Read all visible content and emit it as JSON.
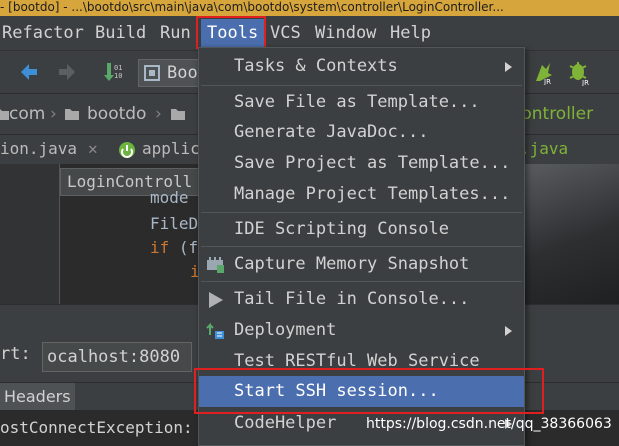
{
  "window": {
    "title": "- [bootdo] - ...\\bootdo\\src\\main\\java\\com\\bootdo\\system\\controller\\LoginController..."
  },
  "menubar": {
    "items": [
      {
        "label": "Refactor"
      },
      {
        "label": "Build"
      },
      {
        "label": "Run"
      },
      {
        "label": "Tools",
        "active": true
      },
      {
        "label": "VCS"
      },
      {
        "label": "Window"
      },
      {
        "label": "Help"
      }
    ]
  },
  "toolbar": {
    "run_config_label": "Boo",
    "icons": [
      "back-arrow-icon",
      "forward-arrow-icon",
      "build-icon",
      "run-config-icon",
      "jrebel-icon",
      "jrebel-debug-icon"
    ]
  },
  "breadcrumbs": {
    "items": [
      "com",
      "bootdo",
      "controller"
    ]
  },
  "tabs": {
    "items": [
      "ion.java",
      "applic",
      ".java"
    ]
  },
  "editor": {
    "popup_label": "LoginControll",
    "lines": [
      {
        "text": "mode"
      },
      {
        "text": "FileD"
      },
      {
        "kw": "if",
        "text": " (f"
      },
      {
        "text": "i"
      }
    ]
  },
  "run_panel": {
    "url_label": "rt:",
    "url_value": "ocalhost:8080",
    "headers_tab": "Headers",
    "console_text": "ostConnectException:"
  },
  "tools_menu": {
    "items": [
      {
        "label": "Tasks & Contexts",
        "submenu": true
      },
      {
        "label": "Save File as Template..."
      },
      {
        "label": "Generate JavaDoc..."
      },
      {
        "label": "Save Project as Template..."
      },
      {
        "label": "Manage Project Templates..."
      },
      {
        "label": "IDE Scripting Console"
      },
      {
        "label": "Capture Memory Snapshot",
        "icon": "memory-snapshot-icon"
      },
      {
        "label": "Tail File in Console...",
        "icon": "play-icon"
      },
      {
        "label": "Deployment",
        "icon": "deployment-icon",
        "submenu": true
      },
      {
        "label": "Test RESTful Web Service"
      },
      {
        "label": "Start SSH session...",
        "selected": true
      },
      {
        "label": "CodeHelper",
        "submenu": true
      }
    ]
  },
  "watermark": "https://blog.csdn.net/qq_38366063",
  "colors": {
    "selection": "#4b6eaf",
    "highlight_box": "#e02020",
    "title_bar": "#d6a53c"
  }
}
